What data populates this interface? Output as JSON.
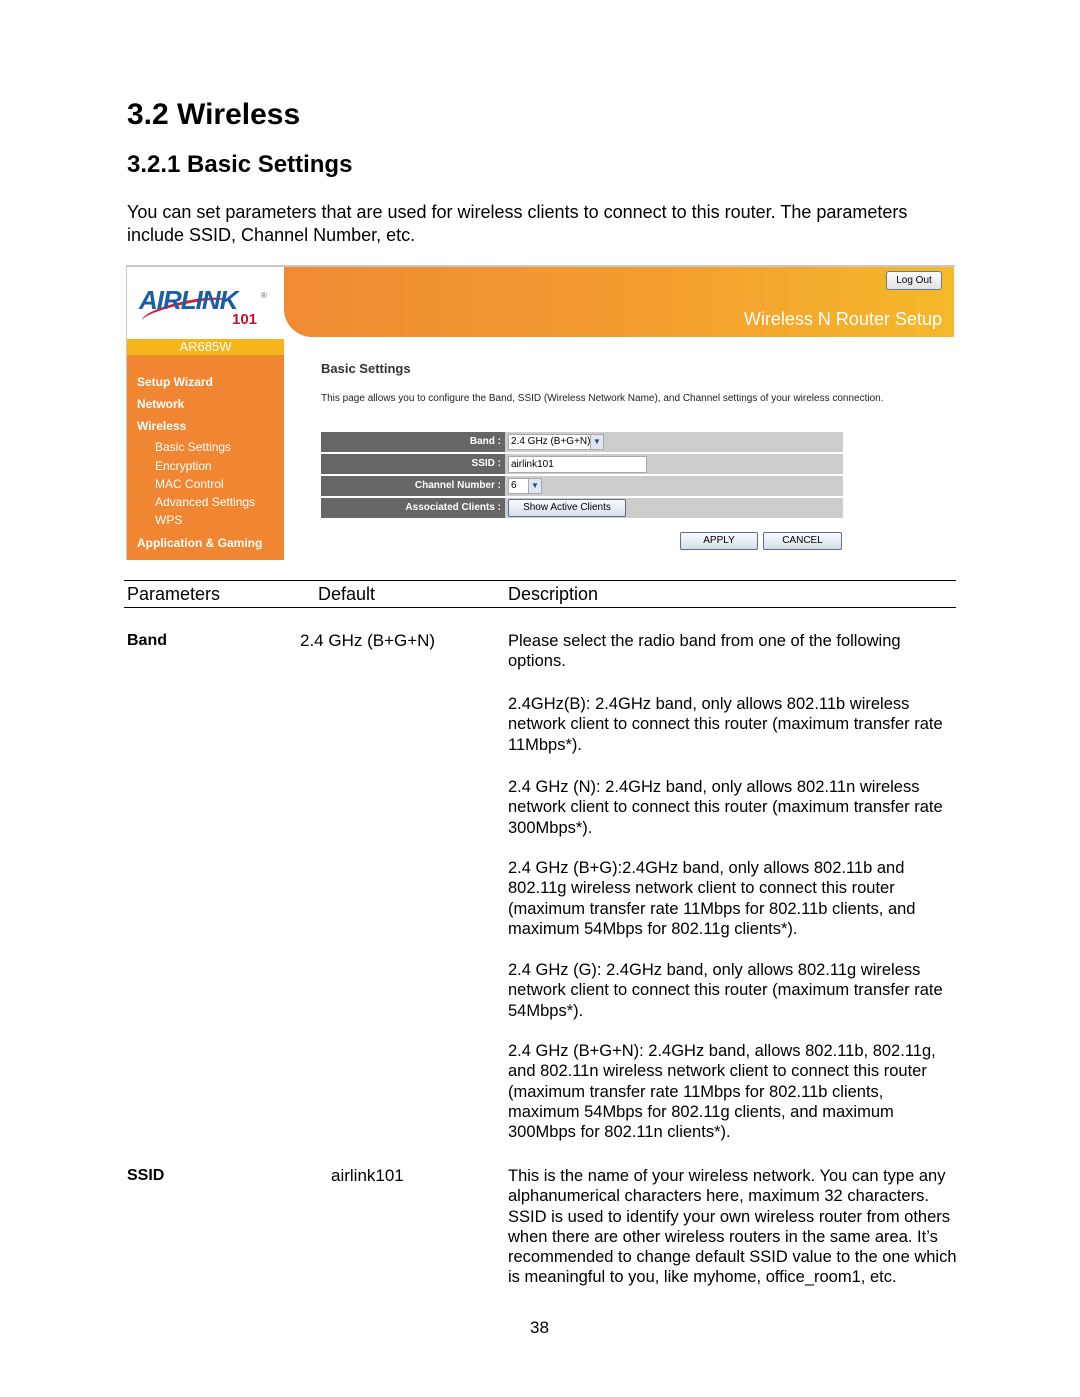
{
  "document": {
    "section_title": "3.2 Wireless",
    "subsection_title": "3.2.1 Basic Settings",
    "intro": "You can set parameters that are used for wireless clients to connect to this router. The parameters include SSID, Channel Number, etc.",
    "page_number": "38"
  },
  "router_ui": {
    "logo": {
      "brand": "AIRLINK",
      "suffix": "101",
      "registered": "®"
    },
    "model": "AR685W",
    "header": {
      "logout_label": "Log Out",
      "title": "Wireless N Router Setup"
    },
    "sidebar": {
      "items": [
        {
          "label": "Setup Wizard",
          "level": "main"
        },
        {
          "label": "Network",
          "level": "main"
        },
        {
          "label": "Wireless",
          "level": "main"
        },
        {
          "label": "Basic Settings",
          "level": "sub"
        },
        {
          "label": "Encryption",
          "level": "sub"
        },
        {
          "label": "MAC Control",
          "level": "sub"
        },
        {
          "label": "Advanced Settings",
          "level": "sub"
        },
        {
          "label": "WPS",
          "level": "sub"
        },
        {
          "label": "Application & Gaming",
          "level": "main"
        }
      ]
    },
    "content": {
      "title": "Basic Settings",
      "description": "This page allows you to configure the Band, SSID (Wireless Network Name), and Channel settings of your wireless connection.",
      "form": {
        "band_label": "Band :",
        "band_value": "2.4 GHz (B+G+N)",
        "ssid_label": "SSID :",
        "ssid_value": "airlink101",
        "channel_label": "Channel Number :",
        "channel_value": "6",
        "clients_label": "Associated Clients :",
        "clients_button": "Show Active Clients"
      },
      "apply_label": "APPLY",
      "cancel_label": "CANCEL"
    },
    "colors": {
      "orange": "#f18632",
      "yellow": "#f6b51b",
      "label_bg": "#666666",
      "value_bg": "#cccccc"
    }
  },
  "param_table": {
    "headers": {
      "parameters": "Parameters",
      "default": "Default",
      "description": "Description"
    },
    "rows": [
      {
        "param": "Band",
        "default": "2.4 GHz (B+G+N)",
        "descriptions": [
          "Please select the radio band from one of the following options.",
          "2.4GHz(B): 2.4GHz band, only allows 802.11b wireless network client to connect this router (maximum transfer rate 11Mbps*).",
          "2.4 GHz (N): 2.4GHz band, only allows 802.11n wireless network client to connect this router (maximum transfer rate 300Mbps*).",
          "2.4 GHz (B+G):2.4GHz band, only allows 802.11b and 802.11g wireless network client to connect this router (maximum transfer rate 11Mbps for 802.11b clients, and maximum 54Mbps for 802.11g clients*).",
          "2.4 GHz (G): 2.4GHz band, only allows 802.11g wireless network client to connect this router (maximum transfer rate 54Mbps*).",
          "2.4 GHz (B+G+N): 2.4GHz band, allows 802.11b, 802.11g, and 802.11n wireless network client to connect this router (maximum transfer rate 11Mbps for 802.11b clients, maximum 54Mbps for 802.11g clients, and maximum 300Mbps for 802.11n clients*)."
        ]
      },
      {
        "param": "SSID",
        "default": "airlink101",
        "descriptions": [
          "This is the name of your wireless network. You can type any alphanumerical characters here, maximum 32 characters. SSID is used to identify your own wireless router from others when there are other wireless routers in the same area. It’s recommended to change default SSID value to the one which is meaningful to you, like myhome, office_room1, etc."
        ]
      }
    ]
  }
}
